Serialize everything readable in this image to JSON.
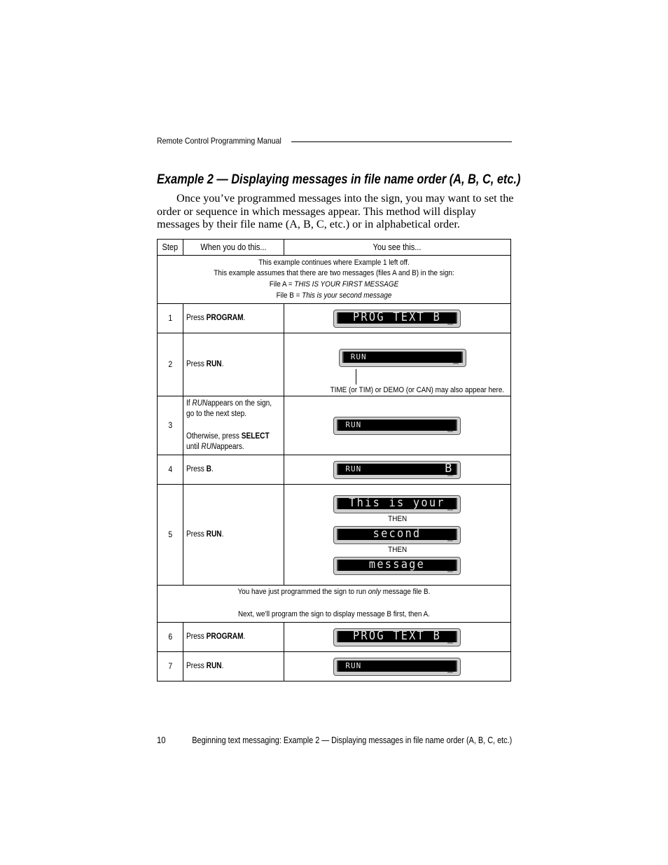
{
  "header": {
    "running_title": "Remote Control Programming Manual"
  },
  "section": {
    "title": "Example 2 — Displaying messages in file name order (A, B, C, etc.)",
    "intro": "Once you’ve programmed messages into the sign, you may want to set the order or sequence in which messages appear. This method will display messages by their file name (A, B, C, etc.) or in alphabetical order."
  },
  "table": {
    "headers": {
      "step": "Step",
      "do": "When you do this...",
      "see": "You see this..."
    },
    "note1": {
      "line1": "This example continues where Example 1 left off.",
      "line2": "This example assumes that there are two messages (files A and B) in the sign:",
      "fileA_label": "File A = ",
      "fileA_value": "THIS IS YOUR FIRST MESSAGE",
      "fileB_label": "File B = ",
      "fileB_value": "This is your second message"
    },
    "rows": [
      {
        "step": "1",
        "prefix": "Press ",
        "key": "PROGRAM",
        "suffix": ".",
        "display": "PROG TEXT B"
      },
      {
        "step": "2",
        "prefix": "Press ",
        "key": "RUN",
        "suffix": ".",
        "display": "RUN",
        "callout": "TIME (or TIM) or DEMO (or CAN) may also appear here."
      },
      {
        "step": "3",
        "line1a": "If ",
        "line1b": "RUN",
        "line1c": "appears on the sign,",
        "line2": "go to the next step.",
        "line3a": "Otherwise, press ",
        "line3b": "SELECT",
        "line4a": "until ",
        "line4b": "RUN",
        "line4c": "appears.",
        "display": "RUN"
      },
      {
        "step": "4",
        "prefix": "Press ",
        "key": "B",
        "suffix": ".",
        "display": "RUN",
        "display_right": "B"
      },
      {
        "step": "5",
        "prefix": "Press ",
        "key": "RUN",
        "suffix": ".",
        "displays": [
          "This is your",
          "second",
          "message"
        ],
        "then": "THEN"
      },
      {
        "step": "6",
        "prefix": "Press ",
        "key": "PROGRAM",
        "suffix": ".",
        "display": "PROG TEXT B"
      },
      {
        "step": "7",
        "prefix": "Press ",
        "key": "RUN",
        "suffix": ".",
        "display": "RUN"
      }
    ],
    "note2": {
      "line1a": "You have just programmed the sign to run ",
      "line1b": "only",
      "line1c": " message file B.",
      "line2": "Next, we’ll program the sign to display message B first, then A."
    }
  },
  "footer": {
    "page_number": "10",
    "text": "Beginning text messaging: Example 2 — Displaying messages in file name order (A, B, C, etc.)"
  }
}
